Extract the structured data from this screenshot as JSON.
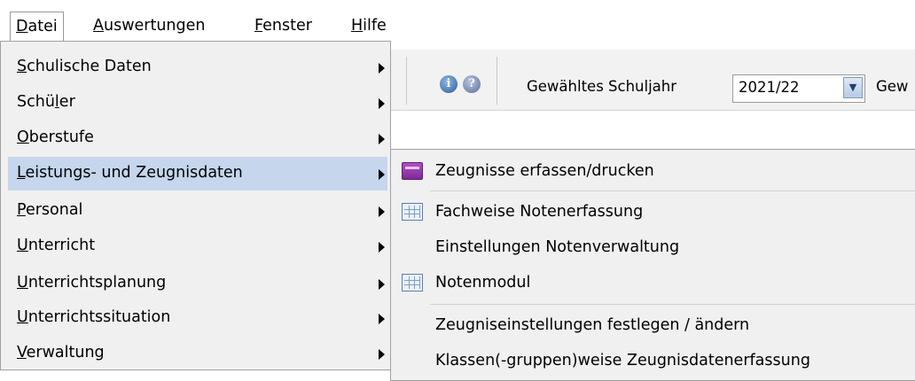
{
  "menubar": {
    "items": [
      {
        "label": "Datei",
        "mnemonic": "D",
        "rest": "atei"
      },
      {
        "label": "Auswertungen",
        "mnemonic": "A",
        "rest": "uswertungen"
      },
      {
        "label": "Fenster",
        "mnemonic": "F",
        "rest": "enster"
      },
      {
        "label": "Hilfe",
        "mnemonic": "H",
        "rest": "ilfe"
      }
    ]
  },
  "toolbar": {
    "info_icon": "info-icon",
    "help_icon": "help-icon",
    "schooljear_label": "Gewähltes Schuljahr",
    "schooljear_value": "2021/22",
    "truncated_label": "Gew"
  },
  "menu": {
    "items": [
      {
        "pre": "",
        "mn": "S",
        "post": "chulische Daten"
      },
      {
        "pre": "Schü",
        "mn": "l",
        "post": "er"
      },
      {
        "pre": "",
        "mn": "O",
        "post": "berstufe"
      },
      {
        "pre": "",
        "mn": "L",
        "post": "eistungs- und Zeugnisdaten"
      },
      {
        "pre": "",
        "mn": "P",
        "post": "ersonal"
      },
      {
        "pre": "",
        "mn": "U",
        "post": "nterricht"
      },
      {
        "pre": "",
        "mn": "U",
        "post": "nterrichtsplanung"
      },
      {
        "pre": "",
        "mn": "U",
        "post": "nterrichtssituation"
      },
      {
        "pre": "",
        "mn": "V",
        "post": "erwaltung"
      }
    ]
  },
  "submenu": {
    "items": [
      {
        "label": "Zeugnisse erfassen/drucken",
        "icon": "report-book-icon"
      },
      {
        "label": "Fachweise Notenerfassung",
        "icon": "grid-table-icon"
      },
      {
        "label": "Einstellungen Notenverwaltung",
        "icon": ""
      },
      {
        "label": "Notenmodul",
        "icon": "grid-table-icon"
      },
      {
        "label": "Zeugniseinstellungen festlegen / ändern",
        "icon": ""
      },
      {
        "label": "Klassen(-gruppen)weise Zeugnisdatenerfassung",
        "icon": ""
      }
    ]
  },
  "colors": {
    "highlight": "#c5d6ed",
    "menu_bg": "#f0f0f0"
  }
}
